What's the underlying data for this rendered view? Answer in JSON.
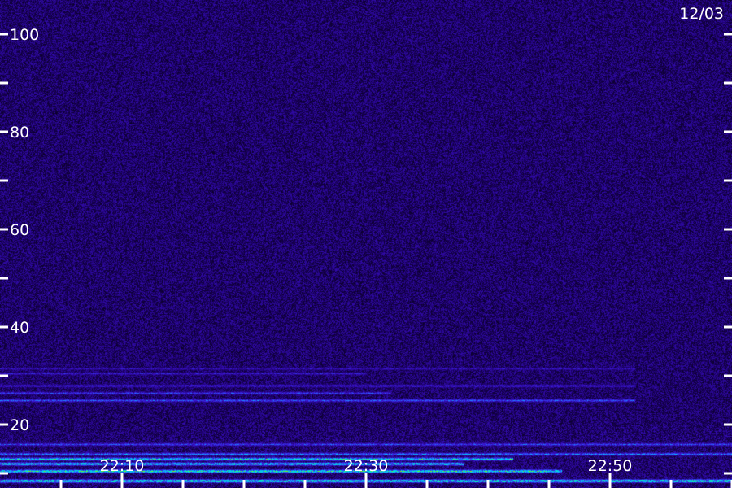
{
  "date_label": "12/03",
  "chart_data": {
    "type": "heatmap",
    "title": "",
    "xlabel": "",
    "ylabel": "",
    "y_ticks": [
      {
        "value": 100,
        "label": "100"
      },
      {
        "value": 90,
        "label": ""
      },
      {
        "value": 80,
        "label": "80"
      },
      {
        "value": 70,
        "label": ""
      },
      {
        "value": 60,
        "label": "60"
      },
      {
        "value": 50,
        "label": ""
      },
      {
        "value": 40,
        "label": "40"
      },
      {
        "value": 30,
        "label": ""
      },
      {
        "value": 20,
        "label": "20"
      },
      {
        "value": 10,
        "label": ""
      }
    ],
    "x_ticks": [
      {
        "time": "22:05",
        "label": ""
      },
      {
        "time": "22:10",
        "label": "22:10"
      },
      {
        "time": "22:15",
        "label": ""
      },
      {
        "time": "22:20",
        "label": ""
      },
      {
        "time": "22:25",
        "label": ""
      },
      {
        "time": "22:30",
        "label": "22:30"
      },
      {
        "time": "22:35",
        "label": ""
      },
      {
        "time": "22:40",
        "label": ""
      },
      {
        "time": "22:45",
        "label": ""
      },
      {
        "time": "22:50",
        "label": "22:50"
      },
      {
        "time": "22:55",
        "label": ""
      },
      {
        "time": "23:00",
        "label": ""
      }
    ],
    "x_range": [
      "22:00",
      "23:00"
    ],
    "y_range": [
      7,
      107
    ],
    "background_level": 0.18,
    "bands": [
      {
        "y": 8.5,
        "intensity": 0.95,
        "x_start": "22:00",
        "x_end": "23:00"
      },
      {
        "y": 10.5,
        "intensity": 0.9,
        "x_start": "22:00",
        "x_end": "22:46"
      },
      {
        "y": 12.0,
        "intensity": 0.85,
        "x_start": "22:00",
        "x_end": "22:38"
      },
      {
        "y": 13.0,
        "intensity": 0.8,
        "x_start": "22:00",
        "x_end": "22:42"
      },
      {
        "y": 14.0,
        "intensity": 0.6,
        "x_start": "22:00",
        "x_end": "23:00"
      },
      {
        "y": 16.0,
        "intensity": 0.5,
        "x_start": "22:00",
        "x_end": "23:00"
      },
      {
        "y": 25.0,
        "intensity": 0.55,
        "x_start": "22:00",
        "x_end": "22:52"
      },
      {
        "y": 26.5,
        "intensity": 0.5,
        "x_start": "22:00",
        "x_end": "22:32"
      },
      {
        "y": 28.0,
        "intensity": 0.45,
        "x_start": "22:00",
        "x_end": "22:52"
      },
      {
        "y": 30.5,
        "intensity": 0.4,
        "x_start": "22:00",
        "x_end": "22:30"
      },
      {
        "y": 31.5,
        "intensity": 0.35,
        "x_start": "22:00",
        "x_end": "22:52"
      }
    ],
    "colorscale": [
      "#000000",
      "#1a0060",
      "#3a10c8",
      "#2f4fff",
      "#00c8ff",
      "#00ffb0",
      "#7fff00"
    ]
  }
}
